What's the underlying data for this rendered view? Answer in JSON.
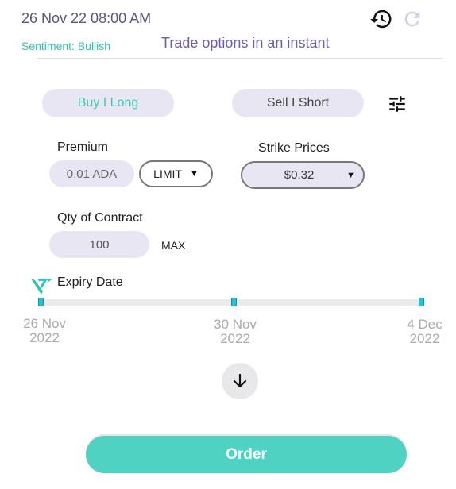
{
  "header": {
    "datetime": "26 Nov 22 08:00 AM",
    "sentiment": "Sentiment: Bullish",
    "tagline": "Trade options in an instant",
    "history_icon": "history-icon",
    "refresh_icon": "refresh-icon"
  },
  "trade_side": {
    "buy_label": "Buy I Long",
    "sell_label": "Sell I Short",
    "selected": "buy",
    "filter_icon": "sliders-icon"
  },
  "premium": {
    "label": "Premium",
    "value": "0.01 ADA",
    "order_type": "LIMIT"
  },
  "strike": {
    "label": "Strike Prices",
    "value": "$0.32"
  },
  "quantity": {
    "label": "Qty of Contract",
    "value": "100",
    "max_label": "MAX"
  },
  "expiry": {
    "label": "Expiry Date",
    "dates": [
      {
        "day": "26 Nov",
        "year": "2022"
      },
      {
        "day": "30 Nov",
        "year": "2022"
      },
      {
        "day": "4 Dec",
        "year": "2022"
      }
    ]
  },
  "actions": {
    "expand_icon": "arrow-down-icon",
    "order_label": "Order"
  },
  "colors": {
    "accent": "#4fd2c1",
    "accent_text": "#3fc7b4",
    "pill_bg": "#e9e6f3",
    "tick": "#26c3d6"
  }
}
